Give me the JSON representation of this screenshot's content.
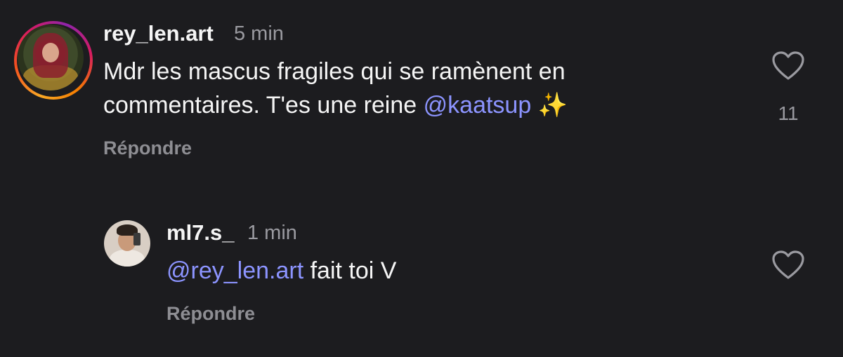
{
  "comments": [
    {
      "username": "rey_len.art",
      "timestamp": "5 min",
      "text_line1": "Mdr les mascus fragiles qui se ramènent en",
      "text_line2_prefix": "commentaires. T'es une reine ",
      "mention": "@kaatsup",
      "emoji": "✨",
      "reply_label": "Répondre",
      "like_count": "11",
      "like_icon": "heart-outline-icon"
    },
    {
      "username": "ml7.s_",
      "timestamp": "1 min",
      "mention": "@rey_len.art",
      "text_suffix": " fait toi V",
      "reply_label": "Répondre",
      "like_icon": "heart-outline-icon"
    }
  ],
  "colors": {
    "background": "#1c1c1f",
    "text": "#f5f5f5",
    "muted": "#9a9aa0",
    "mention": "#8c94ff"
  }
}
